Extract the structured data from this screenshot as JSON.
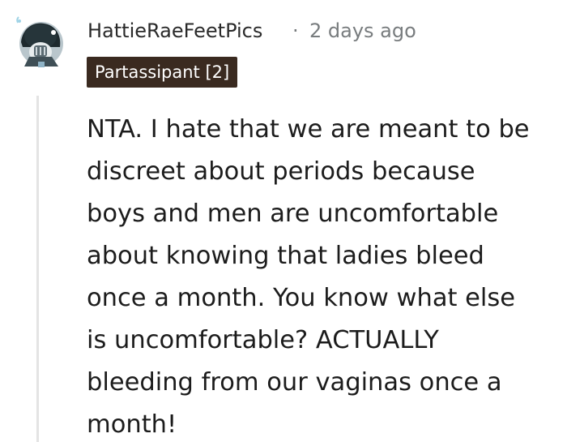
{
  "comment": {
    "author": "HattieRaeFeetPics",
    "separator": "·",
    "timestamp": "2 days ago",
    "flair": "Partassipant [2]",
    "avatar_icon": "snoo-avatar-icon",
    "body_lines": [
      "NTA. I hate that we are meant to be",
      "discreet about periods because",
      "boys and men are uncomfortable",
      "about knowing that ladies bleed",
      "once a month. You know what else",
      "is uncomfortable? ACTUALLY",
      "bleeding from our vaginas once a",
      "month!"
    ]
  },
  "colors": {
    "flair_background": "#3a2a20",
    "flair_text": "#ffffff",
    "meta_text": "#787c7e",
    "body_text": "#1c1c1c",
    "thread_line": "#e4e4e4"
  }
}
